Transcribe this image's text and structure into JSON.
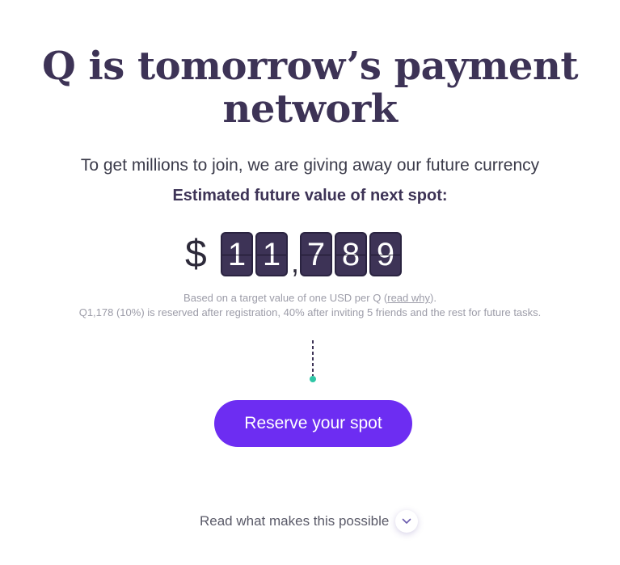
{
  "hero": {
    "title_line1": "Q is tomorrow’s payment",
    "title_line2": "network",
    "subtitle": "To get millions to join, we are giving away our future currency",
    "estimate_label": "Estimated future value of next spot:"
  },
  "counter": {
    "currency": "$",
    "digits_group1": [
      "1",
      "1"
    ],
    "separator": ",",
    "digits_group2": [
      "7",
      "8",
      "9"
    ]
  },
  "footnote": {
    "line1_before": "Based on a target value of one USD per Q (",
    "line1_link": "read why",
    "line1_after": ").",
    "line2": "Q1,178 (10%) is reserved after registration, 40% after inviting 5 friends and the rest for future tasks."
  },
  "cta": {
    "label": "Reserve your spot"
  },
  "readmore": {
    "label": "Read what makes this possible",
    "icon": "chevron-down-icon"
  },
  "colors": {
    "heading": "#3d3356",
    "button": "#6d2df2",
    "dot": "#2fc6a6",
    "muted": "#9c9ca8"
  }
}
